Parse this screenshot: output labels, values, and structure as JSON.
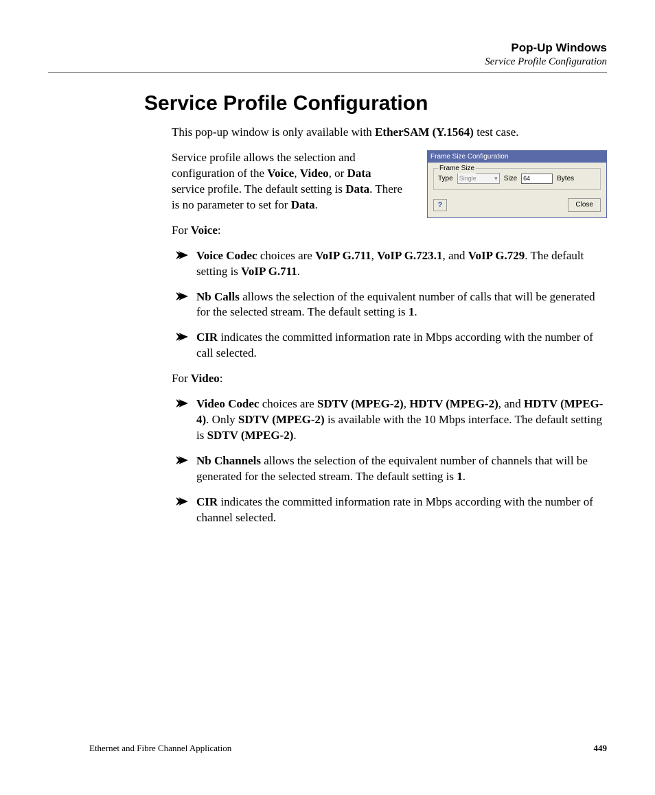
{
  "header": {
    "title": "Pop-Up Windows",
    "subtitle": "Service Profile Configuration"
  },
  "h1": "Service Profile Configuration",
  "intro1_pre": "This pop-up window is only available with ",
  "intro1_bold": "EtherSAM (Y.1564)",
  "intro1_post": " test case.",
  "intro2": {
    "t1": "Service profile allows the selection and configuration of the ",
    "b1": "Voice",
    "t2": ", ",
    "b2": "Video",
    "t3": ", or ",
    "b3": "Data",
    "t4": " service profile. The default setting is ",
    "b4": "Data",
    "t5": ". There is no parameter to set for ",
    "b5": "Data",
    "t6": "."
  },
  "figure": {
    "title": "Frame Size Configuration",
    "legend": "Frame Size",
    "type_label": "Type",
    "type_value": "Single",
    "size_label": "Size",
    "size_value": "64",
    "unit": "Bytes",
    "close": "Close",
    "help_glyph": "?"
  },
  "voice_label_pre": "For ",
  "voice_label_b": "Voice",
  "voice_label_post": ":",
  "voice_items": [
    {
      "b1": "Voice Codec",
      "t1": " choices are ",
      "b2": "VoIP G.711",
      "t2": ", ",
      "b3": "VoIP G.723.1",
      "t3": ", and ",
      "b4": "VoIP G.729",
      "t4": ". The default setting is ",
      "b5": "VoIP G.711",
      "t5": "."
    },
    {
      "b1": "Nb Calls",
      "t1": " allows the selection of the equivalent number of calls that will be generated for the selected stream. The default setting is ",
      "b2": "1",
      "t2": "."
    },
    {
      "b1": "CIR",
      "t1": " indicates the committed information rate in Mbps according with the number of call selected."
    }
  ],
  "video_label_pre": "For ",
  "video_label_b": "Video",
  "video_label_post": ":",
  "video_items": [
    {
      "b1": "Video Codec",
      "t1": " choices are ",
      "b2": "SDTV (MPEG-2)",
      "t2": ", ",
      "b3": "HDTV (MPEG-2)",
      "t3": ", and ",
      "b4": "HDTV (MPEG-4)",
      "t4": ". Only ",
      "b5": "SDTV (MPEG-2)",
      "t5": " is available with the 10 Mbps interface. The default setting is ",
      "b6": "SDTV (MPEG-2)",
      "t6": "."
    },
    {
      "b1": "Nb Channels",
      "t1": " allows the selection of the equivalent number of channels that will be generated for the selected stream. The default setting is ",
      "b2": "1",
      "t2": "."
    },
    {
      "b1": "CIR",
      "t1": " indicates the committed information rate in Mbps according with the number of channel selected."
    }
  ],
  "footer": {
    "left": "Ethernet and Fibre Channel Application",
    "page": "449"
  }
}
